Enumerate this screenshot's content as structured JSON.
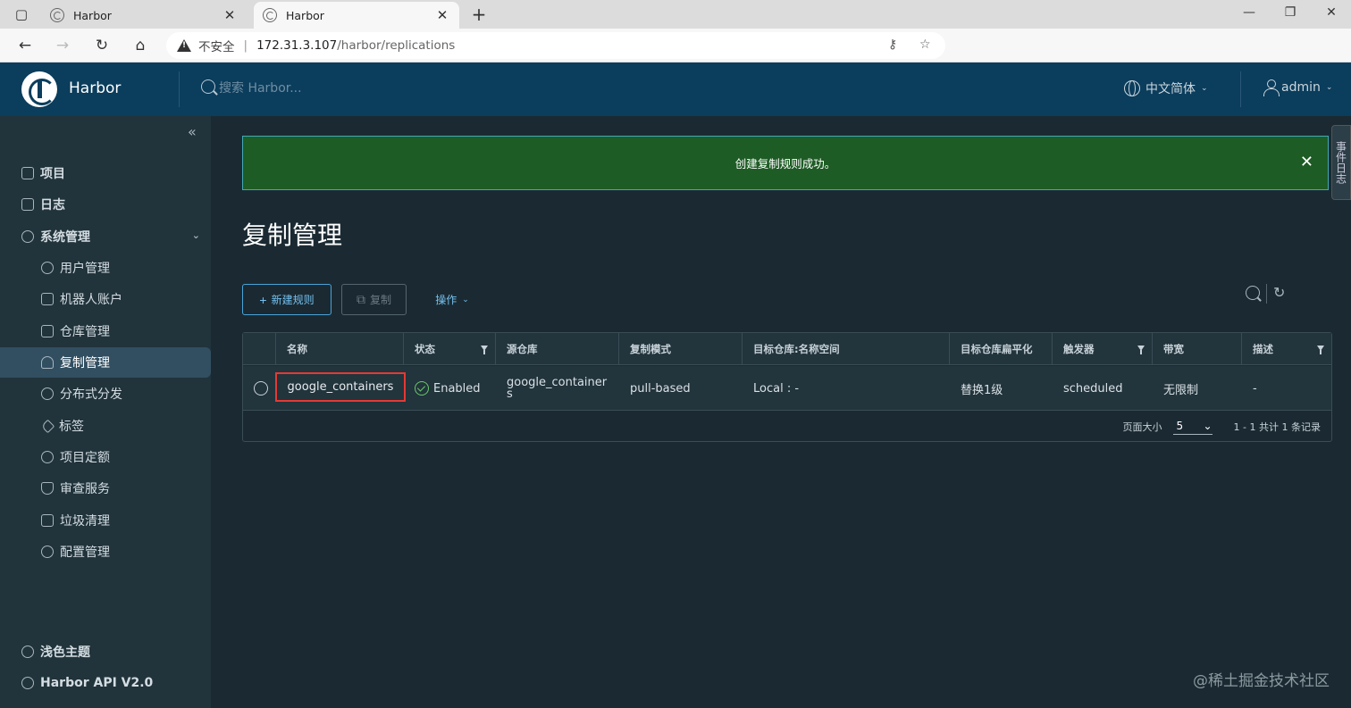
{
  "browser": {
    "tabs": [
      {
        "title": "Harbor",
        "active": false
      },
      {
        "title": "Harbor",
        "active": true
      }
    ],
    "insecure_label": "不安全",
    "url_host": "172.31.3.107",
    "url_path": "/harbor/replications"
  },
  "header": {
    "brand": "Harbor",
    "search_placeholder": "搜索 Harbor...",
    "language": "中文简体",
    "user": "admin"
  },
  "sidebar": {
    "items": [
      {
        "label": "项目",
        "level": "top",
        "icon": "projects-icon"
      },
      {
        "label": "日志",
        "level": "top",
        "icon": "logs-icon"
      },
      {
        "label": "系统管理",
        "level": "top",
        "icon": "admin-icon",
        "expanded": true
      },
      {
        "label": "用户管理",
        "level": "sub",
        "icon": "users-icon"
      },
      {
        "label": "机器人账户",
        "level": "sub",
        "icon": "robot-icon"
      },
      {
        "label": "仓库管理",
        "level": "sub",
        "icon": "registry-icon"
      },
      {
        "label": "复制管理",
        "level": "sub",
        "icon": "replication-icon",
        "active": true
      },
      {
        "label": "分布式分发",
        "level": "sub",
        "icon": "distribution-icon"
      },
      {
        "label": "标签",
        "level": "sub",
        "icon": "tag-icon"
      },
      {
        "label": "项目定额",
        "level": "sub",
        "icon": "quota-icon"
      },
      {
        "label": "审查服务",
        "level": "sub",
        "icon": "scanner-icon"
      },
      {
        "label": "垃圾清理",
        "level": "sub",
        "icon": "trash-icon"
      },
      {
        "label": "配置管理",
        "level": "sub",
        "icon": "settings-icon"
      }
    ],
    "footer": {
      "theme": "浅色主题",
      "api": "Harbor API V2.0"
    }
  },
  "main": {
    "alert": "创建复制规则成功。",
    "side_tab": "事件日志",
    "title": "复制管理",
    "toolbar": {
      "new_rule": "新建规则",
      "copy": "复制",
      "actions": "操作"
    },
    "table": {
      "columns": [
        "名称",
        "状态",
        "源仓库",
        "复制模式",
        "目标仓库:名称空间",
        "目标仓库扁平化",
        "触发器",
        "带宽",
        "描述"
      ],
      "rows": [
        {
          "name": "google_containers",
          "status": "Enabled",
          "source": "google_containers",
          "mode": "pull-based",
          "target": "Local : -",
          "flatten": "替换1级",
          "trigger": "scheduled",
          "bandwidth": "无限制",
          "description": "-"
        }
      ],
      "page_size_label": "页面大小",
      "page_size": "5",
      "pagination": "1 - 1 共计 1 条记录"
    }
  },
  "watermark": "@稀土掘金技术社区",
  "colors": {
    "header_bg": "#0b3d5c",
    "sidebar_bg": "#21333b",
    "main_bg": "#1b2a32",
    "alert_bg": "#1e5c25",
    "accent": "#4aa3d9",
    "highlight": "#e53935"
  }
}
